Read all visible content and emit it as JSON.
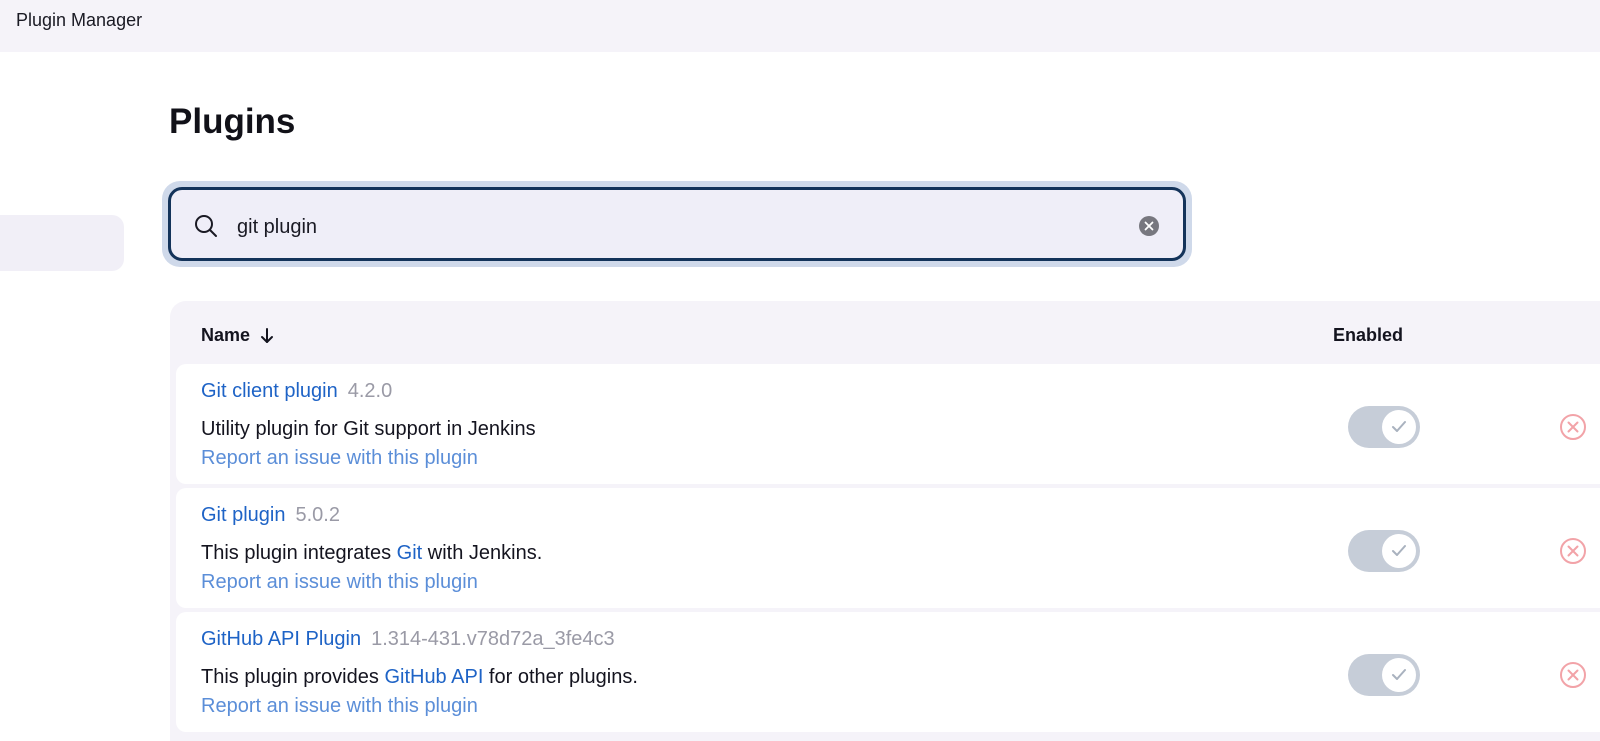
{
  "app": {
    "title": "Plugin Manager"
  },
  "page": {
    "heading": "Plugins"
  },
  "search": {
    "value": "git plugin",
    "placeholder": ""
  },
  "table": {
    "columns": {
      "name": "Name",
      "enabled": "Enabled"
    },
    "sort_icon": "arrow-down-icon",
    "rows": [
      {
        "name": "Git client plugin",
        "version": "4.2.0",
        "desc_before": "Utility plugin for Git support in Jenkins",
        "desc_link": "",
        "desc_after": "",
        "report": "Report an issue with this plugin",
        "enabled": true
      },
      {
        "name": "Git plugin",
        "version": "5.0.2",
        "desc_before": "This plugin integrates ",
        "desc_link": "Git",
        "desc_after": " with Jenkins.",
        "report": "Report an issue with this plugin",
        "enabled": true
      },
      {
        "name": "GitHub API Plugin",
        "version": "1.314-431.v78d72a_3fe4c3",
        "desc_before": "This plugin provides ",
        "desc_link": "GitHub API",
        "desc_after": " for other plugins.",
        "report": "Report an issue with this plugin",
        "enabled": true
      }
    ]
  },
  "colors": {
    "link": "#1e63c6",
    "report_link": "#5b8ed8",
    "toggle_bg": "#c6cdd8",
    "uninstall": "#f2a3a8",
    "search_border": "#13335a"
  }
}
